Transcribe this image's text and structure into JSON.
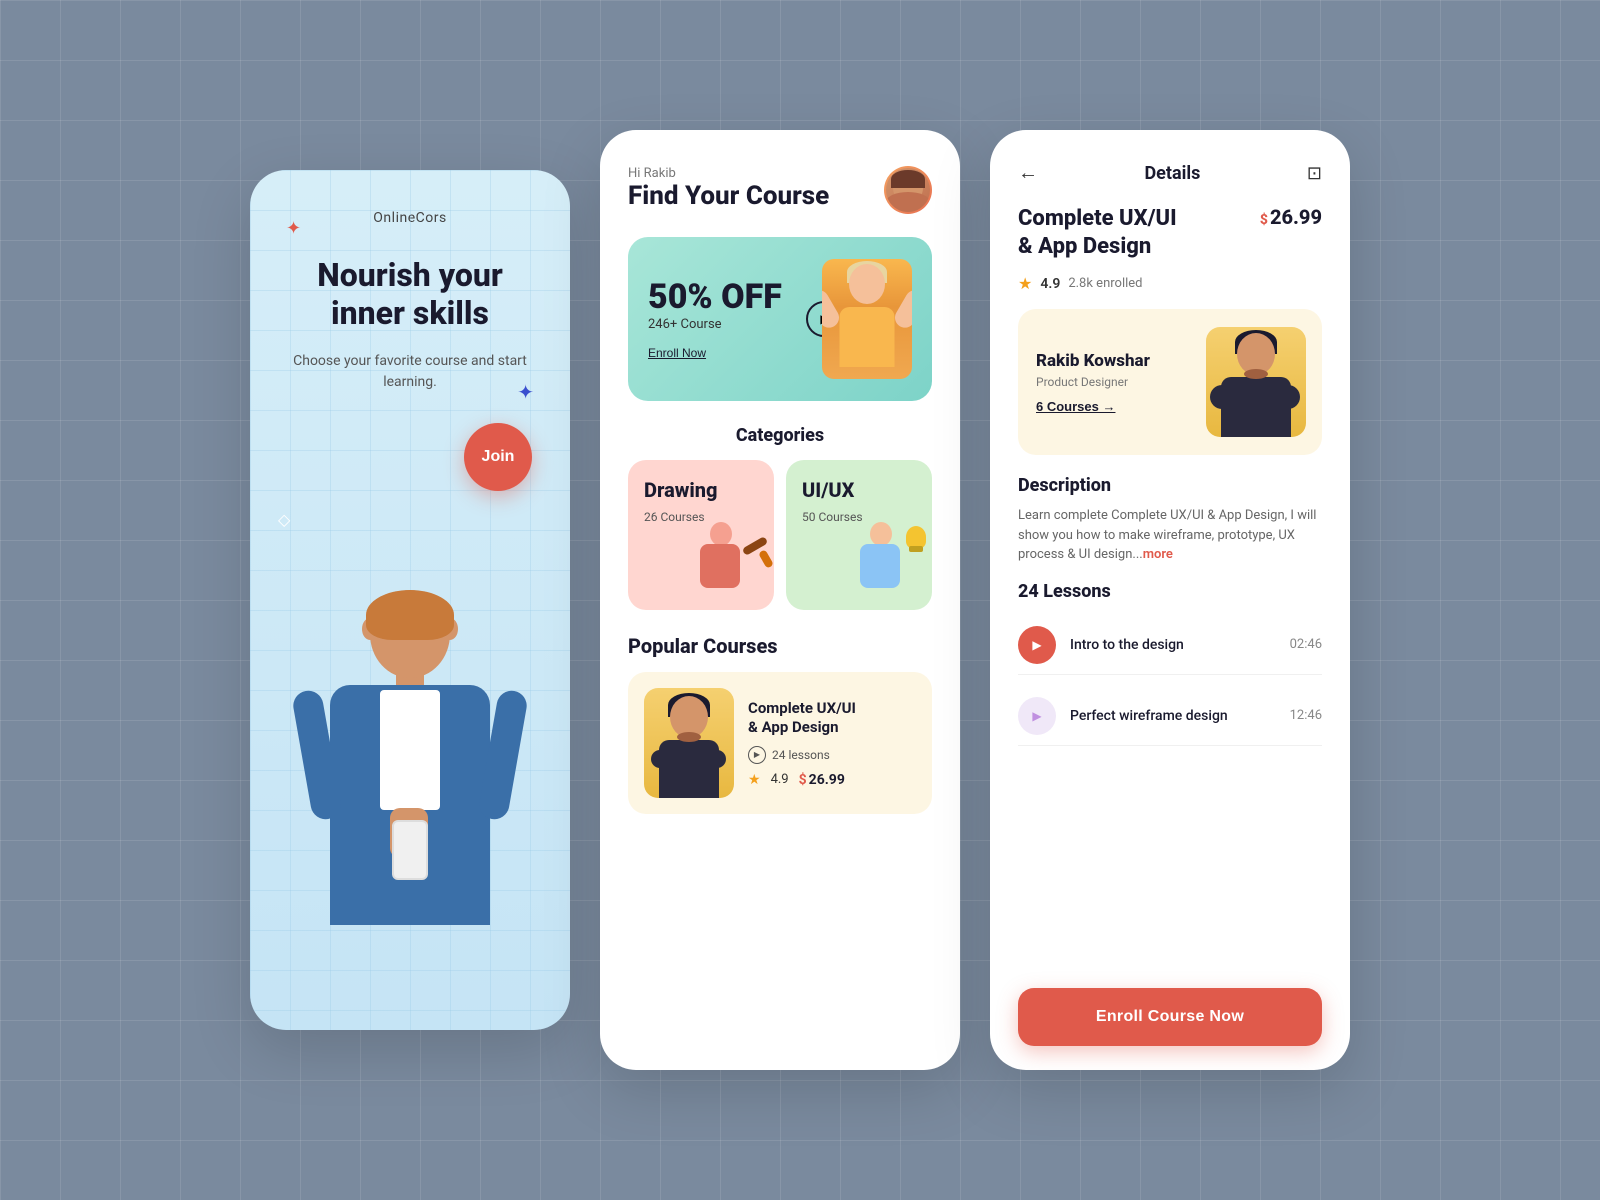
{
  "background": {
    "color": "#7a8a9e"
  },
  "card1": {
    "logo": "OnlineCors",
    "title": "Nourish your inner skills",
    "subtitle": "Choose your favorite course\nand start learning.",
    "join_btn": "Join"
  },
  "card2": {
    "greeting": "Hi Rakib",
    "heading": "Find Your Course",
    "banner": {
      "discount": "50% OFF",
      "count": "246+ Course",
      "enroll_link": "Enroll Now"
    },
    "categories_title": "Categories",
    "categories": [
      {
        "name": "Drawing",
        "count": "26 Courses",
        "theme": "drawing"
      },
      {
        "name": "UI/UX",
        "count": "50 Courses",
        "theme": "uiux"
      }
    ],
    "popular_title": "Popular Courses",
    "popular_courses": [
      {
        "title": "Complete UX/UI\n& App Design",
        "lessons": "24 lessons",
        "rating": "4.9",
        "price": "26.99"
      }
    ]
  },
  "card3": {
    "header_title": "Details",
    "back_label": "←",
    "bookmark_label": "🔖",
    "course_title": "Complete UX/UI\n& App Design",
    "price": "26.99",
    "rating": "4.9",
    "enrolled": "2.8k enrolled",
    "instructor": {
      "name": "Rakib Kowshar",
      "role": "Product Designer",
      "courses_link": "6 Courses →"
    },
    "description_title": "Description",
    "description": "Learn complete Complete UX/UI & App Design, I will show you how to make wireframe, prototype, UX process & UI design...",
    "description_more": "more",
    "lessons_title": "24 Lessons",
    "lessons": [
      {
        "name": "Intro to the design",
        "duration": "02:46",
        "active": true
      },
      {
        "name": "Perfect wireframe design",
        "duration": "12:46",
        "active": false
      }
    ],
    "enroll_btn": "Enroll Course Now"
  }
}
